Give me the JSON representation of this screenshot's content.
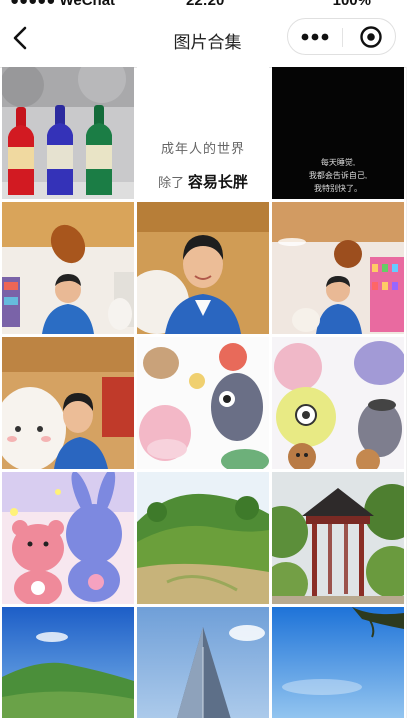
{
  "status_bar": {
    "carrier": "●●●●● WeChat",
    "time": "22:20",
    "battery": "100%"
  },
  "nav": {
    "title": "图片合集",
    "back_icon": "chevron-left-icon",
    "more_icon": "more-dots-icon",
    "close_icon": "target-close-icon"
  },
  "gallery": {
    "tile2_line1": "成年人的世界",
    "tile2_line2_prefix": "除了",
    "tile2_line2_bold": "容易长胖",
    "tile3_line1": "每天睡觉,",
    "tile3_line2": "我都会告诉自己,",
    "tile3_line3": "我特别快了。"
  }
}
